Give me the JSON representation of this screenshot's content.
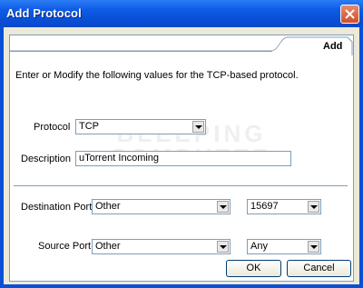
{
  "window": {
    "title": "Add Protocol",
    "close_icon": "close-icon",
    "colors": {
      "titlebar": "#0a4fd8",
      "close": "#d24d28",
      "client": "#ece9d8",
      "border": "#7f9db9"
    }
  },
  "tab": {
    "label": "Add"
  },
  "intro_text": "Enter or Modify the following values for the TCP-based protocol.",
  "watermark": {
    "line1": "BLEEPING",
    "line2": "COMPUTER"
  },
  "protocol": {
    "label": "Protocol",
    "value": "TCP"
  },
  "description": {
    "label": "Description",
    "value": "uTorrent Incoming"
  },
  "destination_port": {
    "label": "Destination Port:",
    "type_value": "Other",
    "port_value": "15697"
  },
  "source_port": {
    "label": "Source Port:",
    "type_value": "Other",
    "port_value": "Any"
  },
  "buttons": {
    "ok": "OK",
    "cancel": "Cancel"
  }
}
